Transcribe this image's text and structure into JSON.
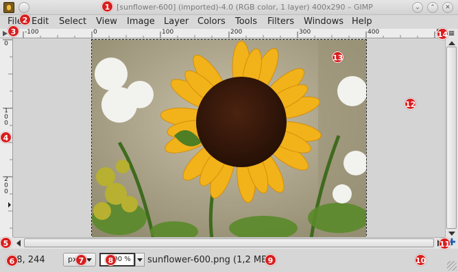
{
  "window": {
    "title": "[sunflower-600] (imported)-4.0 (RGB color, 1 layer) 400x290 – GIMP",
    "buttons": [
      "minimize",
      "maximize",
      "close"
    ]
  },
  "menubar": {
    "items": [
      "File",
      "Edit",
      "Select",
      "View",
      "Image",
      "Layer",
      "Colors",
      "Tools",
      "Filters",
      "Windows",
      "Help"
    ]
  },
  "rulers": {
    "horizontal_labels": [
      "-100",
      "0",
      "100",
      "200",
      "300",
      "400",
      "500"
    ],
    "vertical_labels": [
      "0",
      "100",
      "200"
    ]
  },
  "statusbar": {
    "pointer_coords": "68, 244",
    "unit": "px",
    "zoom": "100 %",
    "message": "sunflower-600.png (1,2 MB)"
  },
  "markers": [
    "1",
    "2",
    "3",
    "4",
    "5",
    "6",
    "7",
    "8",
    "9",
    "10",
    "11",
    "12",
    "13",
    "14"
  ],
  "icons": {
    "app": "gimp-wilber-icon",
    "navigate": "navigate-cross-icon",
    "zoom_to_fit": "zoom-image-icon"
  },
  "colors": {
    "marker": "#d81e1e",
    "canvas_bg": "#d4d4d4",
    "petal": "#f2b21a",
    "center": "#3a1a0c"
  }
}
